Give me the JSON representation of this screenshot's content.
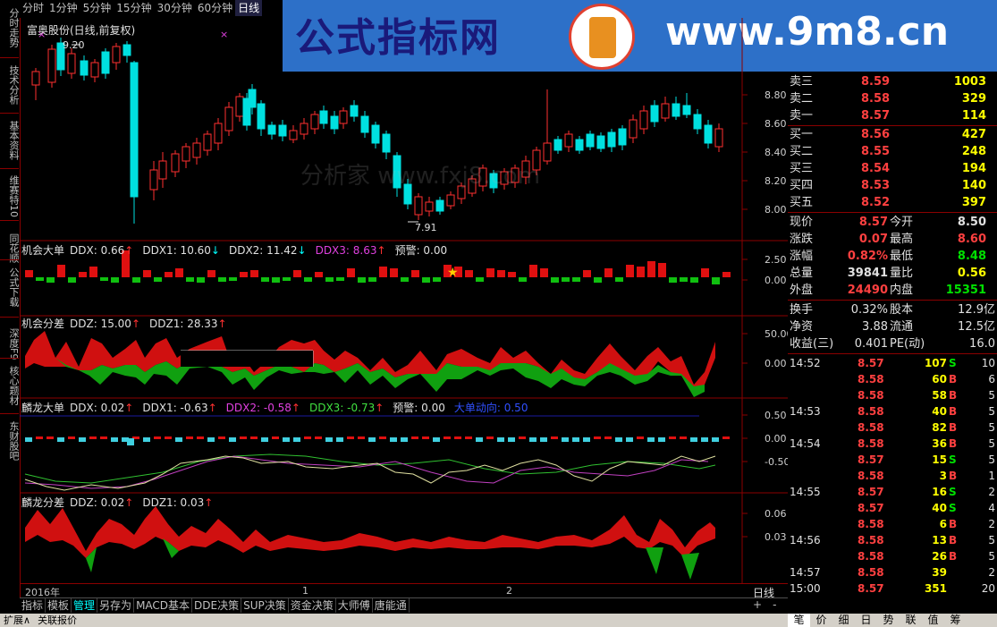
{
  "period_tabs": [
    "分时",
    "1分钟",
    "5分钟",
    "15分钟",
    "30分钟",
    "60分钟",
    "日线"
  ],
  "active_period": "日线",
  "left_tabs": [
    "分时走势",
    "技术分析",
    "基本资料",
    "维赛特10",
    "同花顺",
    "公式下载",
    "深度F9",
    "核心题材",
    "东财股吧"
  ],
  "banner": {
    "left_text": "公式指标网",
    "right_text": "www.9m8.cn",
    "logo_text": "9m8"
  },
  "watermark": "分析家 www.fxj8.com",
  "main_chart": {
    "title": "富奥股份(日线,前复权)",
    "high_label": "9.20",
    "low_label": "7.91",
    "y_ticks": [
      "8.80",
      "8.60",
      "8.40",
      "8.20",
      "8.00"
    ]
  },
  "ind1": {
    "name": "机会大单",
    "items": [
      {
        "text": "DDX: 0.66",
        "arrow": "↑",
        "color": "#e0e0e0",
        "arrow_color": "#ff3030"
      },
      {
        "text": "DDX1: 10.60",
        "arrow": "↓",
        "color": "#e0e0e0",
        "arrow_color": "#00ffff"
      },
      {
        "text": "DDX2: 11.42",
        "arrow": "↓",
        "color": "#e0e0e0",
        "arrow_color": "#00ffff"
      },
      {
        "text": "DDX3: 8.63",
        "arrow": "↑",
        "color": "#e040e0",
        "arrow_color": "#ff3030"
      },
      {
        "text": "预警: 0.00",
        "arrow": "",
        "color": "#e0e0e0",
        "arrow_color": "#ff3030"
      }
    ],
    "y_ticks": [
      "2.50",
      "0.00"
    ]
  },
  "ind2": {
    "name": "机会分差",
    "items": [
      {
        "text": "DDZ: 15.00",
        "arrow": "↑",
        "color": "#e0e0e0",
        "arrow_color": "#ff3030"
      },
      {
        "text": "DDZ1: 28.33",
        "arrow": "↑",
        "color": "#e0e0e0",
        "arrow_color": "#ff3030"
      }
    ],
    "y_ticks": [
      "50.00",
      "0.00"
    ]
  },
  "ind3": {
    "name": "麟龙大单",
    "items": [
      {
        "text": "DDX: 0.02",
        "arrow": "↑",
        "color": "#e0e0e0",
        "arrow_color": "#ff3030"
      },
      {
        "text": "DDX1: -0.63",
        "arrow": "↑",
        "color": "#e0e0e0",
        "arrow_color": "#ff3030"
      },
      {
        "text": "DDX2: -0.58",
        "arrow": "↑",
        "color": "#e040e0",
        "arrow_color": "#ff3030"
      },
      {
        "text": "DDX3: -0.73",
        "arrow": "↑",
        "color": "#40e040",
        "arrow_color": "#ff3030"
      },
      {
        "text": "预警: 0.00",
        "arrow": "",
        "color": "#e0e0e0",
        "arrow_color": "#ff3030"
      },
      {
        "text": "大单动向: 0.50",
        "arrow": "",
        "color": "#3050ff",
        "arrow_color": "#ff3030"
      }
    ],
    "y_ticks": [
      "0.50",
      "0.00",
      "-0.50"
    ]
  },
  "ind4": {
    "name": "麟龙分差",
    "items": [
      {
        "text": "DDZ: 0.02",
        "arrow": "↑",
        "color": "#e0e0e0",
        "arrow_color": "#ff3030"
      },
      {
        "text": "DDZ1: 0.03",
        "arrow": "↑",
        "color": "#e0e0e0",
        "arrow_color": "#ff3030"
      }
    ],
    "y_ticks": [
      "0.06",
      "0.03"
    ]
  },
  "time_axis": {
    "year": "2016年",
    "m1": "1",
    "m2": "2",
    "period": "日线"
  },
  "bottom_tabs": [
    "指标",
    "模板",
    "管理",
    "另存为",
    "MACD基本",
    "DDE决策",
    "SUP决策",
    "资金决策",
    "大师傅",
    "唐能通"
  ],
  "active_bottom_tab": "管理",
  "status_tabs": [
    "扩展∧",
    "关联报价"
  ],
  "bottom_right_controls": [
    "+",
    "-",
    "0"
  ],
  "right_tabs": [
    "笔",
    "价",
    "细",
    "日",
    "势",
    "联",
    "值",
    "筹"
  ],
  "order_book": [
    {
      "label": "卖三",
      "price": "8.59",
      "vol": "1003"
    },
    {
      "label": "卖二",
      "price": "8.58",
      "vol": "329"
    },
    {
      "label": "卖一",
      "price": "8.57",
      "vol": "114"
    },
    {
      "label": "买一",
      "price": "8.56",
      "vol": "427"
    },
    {
      "label": "买二",
      "price": "8.55",
      "vol": "248"
    },
    {
      "label": "买三",
      "price": "8.54",
      "vol": "194"
    },
    {
      "label": "买四",
      "price": "8.53",
      "vol": "140"
    },
    {
      "label": "买五",
      "price": "8.52",
      "vol": "397"
    }
  ],
  "quote": [
    {
      "l1": "现价",
      "v1": "8.57",
      "c1": "red",
      "l2": "今开",
      "v2": "8.50",
      "c2": "wht"
    },
    {
      "l1": "涨跌",
      "v1": "0.07",
      "c1": "red",
      "l2": "最高",
      "v2": "8.60",
      "c2": "red"
    },
    {
      "l1": "涨幅",
      "v1": "0.82%",
      "c1": "red",
      "l2": "最低",
      "v2": "8.48",
      "c2": "grn"
    },
    {
      "l1": "总量",
      "v1": "39841",
      "c1": "wht",
      "l2": "量比",
      "v2": "0.56",
      "c2": "yel"
    },
    {
      "l1": "外盘",
      "v1": "24490",
      "c1": "red",
      "l2": "内盘",
      "v2": "15351",
      "c2": "grn"
    }
  ],
  "stats": [
    {
      "l1": "换手",
      "v1": "0.32%",
      "l2": "股本",
      "v2": "12.9亿"
    },
    {
      "l1": "净资",
      "v1": "3.88",
      "l2": "流通",
      "v2": "12.5亿"
    },
    {
      "l1": "收益(三)",
      "v1": "0.401",
      "l2": "PE(动)",
      "v2": "16.0"
    }
  ],
  "ticks": [
    {
      "t": "14:52",
      "p": "8.57",
      "v": "107",
      "s": "S",
      "n": "10"
    },
    {
      "t": "",
      "p": "8.58",
      "v": "60",
      "s": "B",
      "n": "6"
    },
    {
      "t": "",
      "p": "8.58",
      "v": "58",
      "s": "B",
      "n": "5"
    },
    {
      "t": "14:53",
      "p": "8.58",
      "v": "40",
      "s": "B",
      "n": "5"
    },
    {
      "t": "",
      "p": "8.58",
      "v": "82",
      "s": "B",
      "n": "5"
    },
    {
      "t": "14:54",
      "p": "8.58",
      "v": "36",
      "s": "B",
      "n": "5"
    },
    {
      "t": "",
      "p": "8.57",
      "v": "15",
      "s": "S",
      "n": "5"
    },
    {
      "t": "",
      "p": "8.58",
      "v": "3",
      "s": "B",
      "n": "1"
    },
    {
      "t": "14:55",
      "p": "8.57",
      "v": "16",
      "s": "S",
      "n": "2"
    },
    {
      "t": "",
      "p": "8.57",
      "v": "40",
      "s": "S",
      "n": "4"
    },
    {
      "t": "",
      "p": "8.58",
      "v": "6",
      "s": "B",
      "n": "2"
    },
    {
      "t": "14:56",
      "p": "8.58",
      "v": "13",
      "s": "B",
      "n": "5"
    },
    {
      "t": "",
      "p": "8.58",
      "v": "26",
      "s": "B",
      "n": "5"
    },
    {
      "t": "14:57",
      "p": "8.58",
      "v": "39",
      "s": "",
      "n": "2"
    },
    {
      "t": "15:00",
      "p": "8.57",
      "v": "351",
      "s": "",
      "n": "20"
    }
  ],
  "colors": {
    "up": "#ff3030",
    "down": "#00e0e0",
    "grid": "#8b0000"
  }
}
